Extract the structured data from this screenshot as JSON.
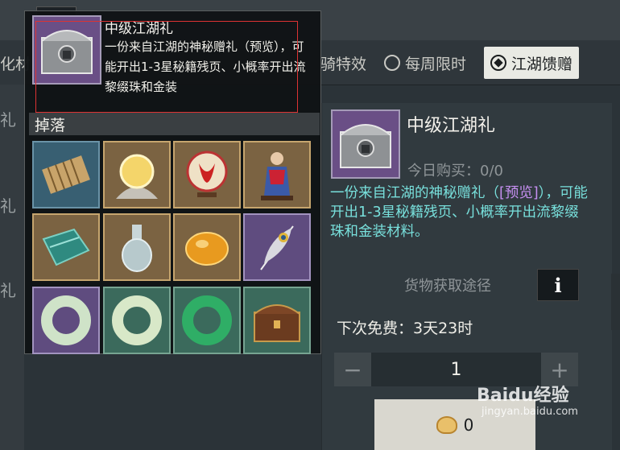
{
  "tabs": {
    "partial_left": "化材",
    "partial_mid": "骑特效",
    "weekly_label": "每周限时",
    "gift_label": "江湖馈赠"
  },
  "left_col": [
    "礼",
    "礼",
    "礼"
  ],
  "detail": {
    "title": "中级江湖礼",
    "buy_today": "今日购买：0/0",
    "desc_before": "一份来自江湖的神秘赠礼（",
    "desc_highlight": "[预览]",
    "desc_after": "），可能开出1-3星秘籍残页、小概率开出流黎缀珠和金装材料。",
    "source_label": "货物获取途径",
    "info_symbol": "i",
    "next_free": "下次免费：3天23时",
    "quantity": "1",
    "minus": "−",
    "plus": "+",
    "price": "0"
  },
  "popup": {
    "title": "中级江湖礼",
    "desc": "一份来自江湖的神秘赠礼（预览），可能开出1-3星秘籍残页、小概率开出流黎缀珠和金装",
    "drop_label": "掉落"
  },
  "drops": [
    {
      "name": "bamboo-scroll",
      "rarity": "blue"
    },
    {
      "name": "glowing-pearl",
      "rarity": "gold"
    },
    {
      "name": "paper-cut-plate",
      "rarity": "gold"
    },
    {
      "name": "opera-figurine",
      "rarity": "gold"
    },
    {
      "name": "green-cloth",
      "rarity": "gold"
    },
    {
      "name": "porcelain-bottle",
      "rarity": "gold"
    },
    {
      "name": "amber-stone",
      "rarity": "gold"
    },
    {
      "name": "peacock-feather",
      "rarity": "purple"
    },
    {
      "name": "jade-ring-white",
      "rarity": "purple"
    },
    {
      "name": "jade-ring-pale",
      "rarity": "green"
    },
    {
      "name": "jade-ring-green",
      "rarity": "green"
    },
    {
      "name": "treasure-chest",
      "rarity": "green"
    }
  ],
  "watermark": {
    "brand": "Baidu经验",
    "url": "jingyan.baidu.com"
  },
  "colors": {
    "accent_desc": "#78e0dc",
    "highlight": "#c58ff0",
    "annotation": "#dd3333"
  }
}
